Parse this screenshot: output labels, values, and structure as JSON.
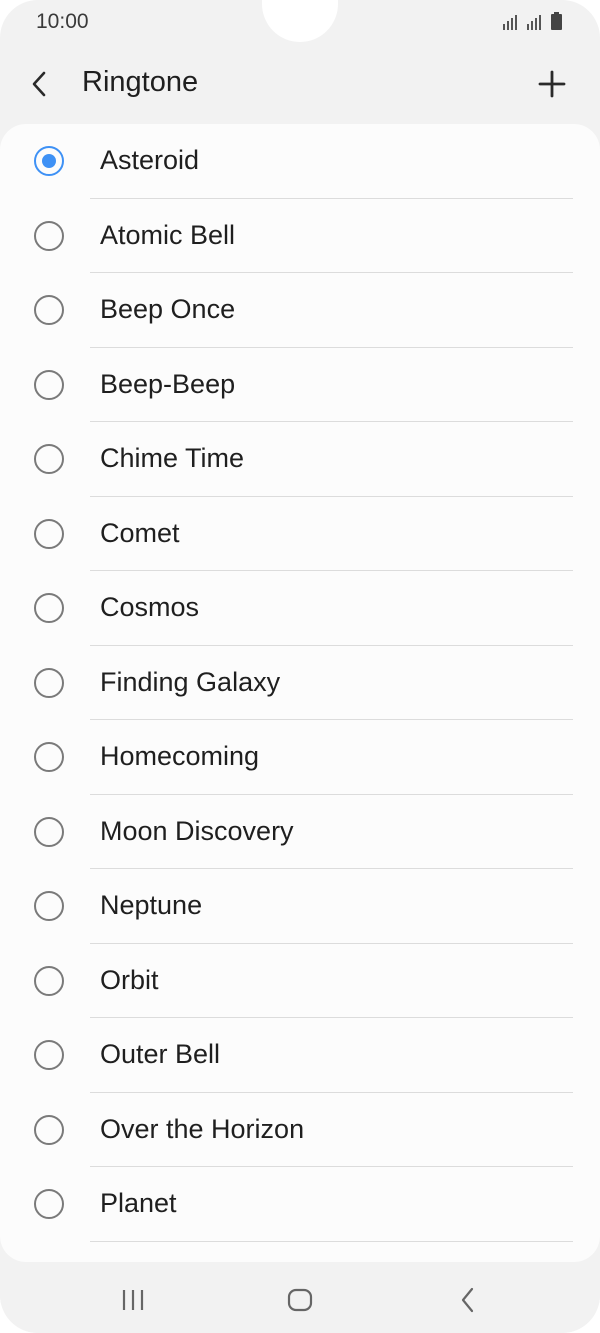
{
  "status_bar": {
    "time": "10:00",
    "icons": [
      "signal-icon",
      "signal-icon",
      "battery-icon"
    ]
  },
  "app_bar": {
    "title": "Ringtone",
    "back_icon": "back-arrow-icon",
    "add_icon": "plus-icon"
  },
  "ringtones": {
    "selected": "Asteroid",
    "items": [
      {
        "label": "Asteroid",
        "checked": true
      },
      {
        "label": "Atomic Bell",
        "checked": false
      },
      {
        "label": "Beep Once",
        "checked": false
      },
      {
        "label": "Beep-Beep",
        "checked": false
      },
      {
        "label": "Chime Time",
        "checked": false
      },
      {
        "label": "Comet",
        "checked": false
      },
      {
        "label": "Cosmos",
        "checked": false
      },
      {
        "label": "Finding Galaxy",
        "checked": false
      },
      {
        "label": "Homecoming",
        "checked": false
      },
      {
        "label": "Moon Discovery",
        "checked": false
      },
      {
        "label": "Neptune",
        "checked": false
      },
      {
        "label": "Orbit",
        "checked": false
      },
      {
        "label": "Outer Bell",
        "checked": false
      },
      {
        "label": "Over the Horizon",
        "checked": false
      },
      {
        "label": "Planet",
        "checked": false
      }
    ]
  },
  "nav_bar": {
    "recents_icon": "recents-icon",
    "home_icon": "home-icon",
    "back_icon": "back-chevron-icon"
  },
  "colors": {
    "accent": "#3e91f5",
    "background": "#f2f2f2",
    "card": "#fcfcfc"
  }
}
